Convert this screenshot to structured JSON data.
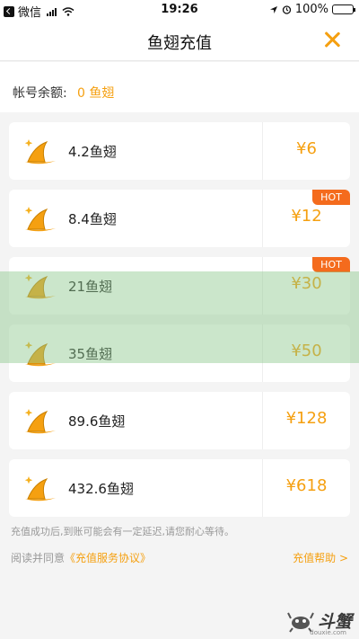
{
  "status_bar": {
    "carrier": "微信",
    "time": "19:26",
    "battery": "100%",
    "battery_level": 1.0
  },
  "header": {
    "title": "鱼翅充值",
    "close_icon": "close-icon"
  },
  "balance": {
    "label": "帐号余额:",
    "value": "0 鱼翅"
  },
  "packages": [
    {
      "amount": "4.2鱼翅",
      "price": "¥6",
      "hot": ""
    },
    {
      "amount": "8.4鱼翅",
      "price": "¥12",
      "hot": "HOT"
    },
    {
      "amount": "21鱼翅",
      "price": "¥30",
      "hot": "HOT"
    },
    {
      "amount": "35鱼翅",
      "price": "¥50",
      "hot": ""
    },
    {
      "amount": "89.6鱼翅",
      "price": "¥128",
      "hot": ""
    },
    {
      "amount": "432.6鱼翅",
      "price": "¥618",
      "hot": ""
    }
  ],
  "footer": {
    "notice": "充值成功后,到账可能会有一定延迟,请您耐心等待。",
    "agreement_prefix": "阅读并同意",
    "agreement_link": "《充值服务协议》",
    "help": "充值帮助 >"
  },
  "watermark": {
    "logo_text": "斗蟹",
    "logo_sub": "douxie.com"
  },
  "colors": {
    "accent": "#f5a011",
    "hot_badge": "#f46b1d",
    "background": "#f4f4f4",
    "watermark_band": "#8cc88c"
  }
}
